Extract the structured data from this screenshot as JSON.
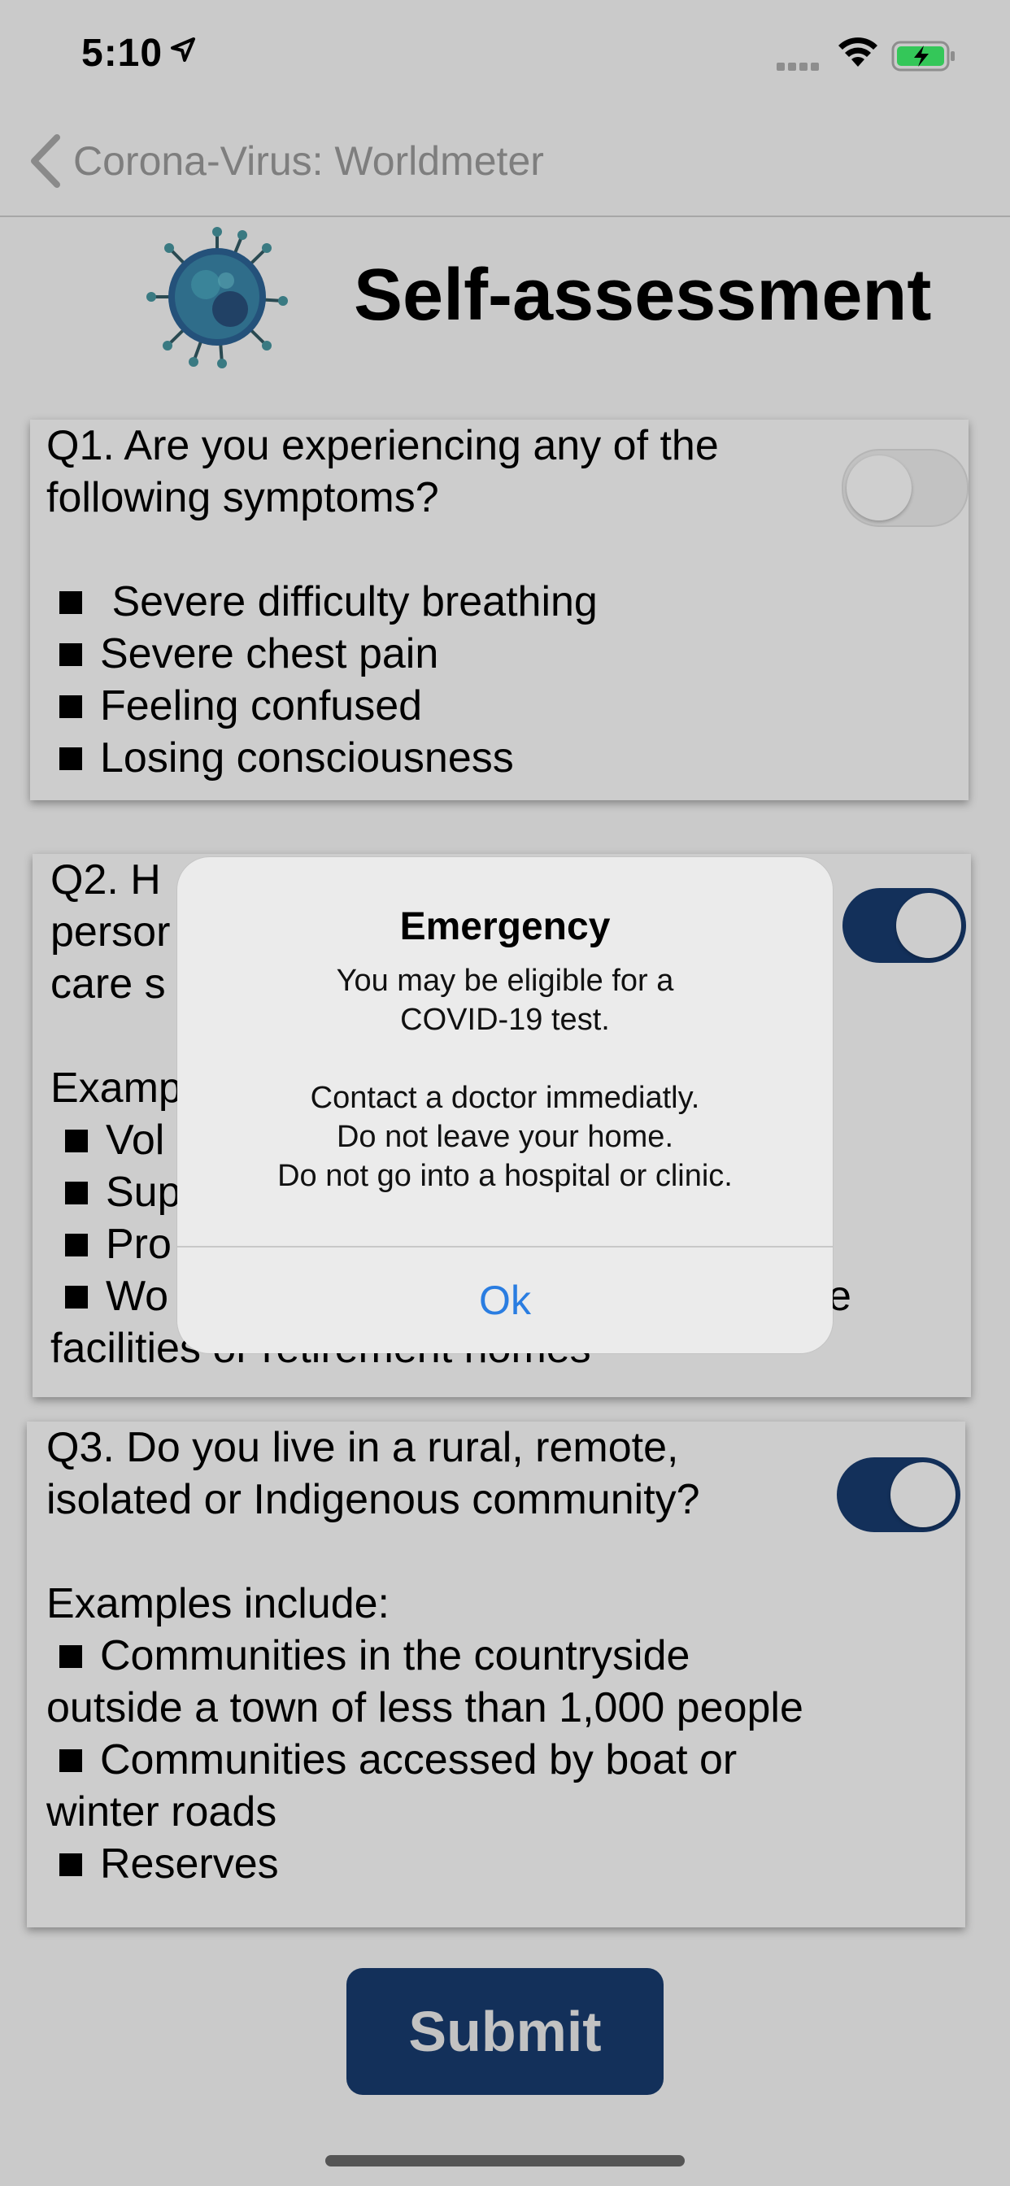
{
  "status_bar": {
    "time": "5:10",
    "icons": [
      "location-arrow-icon",
      "cellular-signal-icon",
      "wifi-icon",
      "battery-charging-icon"
    ]
  },
  "nav": {
    "back_label": "Corona-Virus: Worldmeter",
    "back_icon": "chevron-left-icon"
  },
  "header": {
    "title": "Self-assessment",
    "logo": "virus-icon"
  },
  "q1": {
    "lines": [
      "Q1.  Are you experiencing any of the",
      "following symptoms?"
    ],
    "bullets": [
      " Severe difficulty breathing",
      "Severe chest pain",
      "Feeling confused",
      "Losing consciousness"
    ],
    "toggle_on": false
  },
  "q2": {
    "visible_lines": [
      "Q2.  H",
      "persor",
      "care s",
      "Examp"
    ],
    "visible_bullets": [
      "Vol",
      "Sup",
      "Pro",
      "Wo"
    ],
    "bullet_tail": "e",
    "last_line": "facilities or retirement homes",
    "toggle_on": true
  },
  "q3": {
    "lines": [
      "Q3.  Do you live in a rural, remote,",
      "isolated or Indigenous community?",
      "Examples include:"
    ],
    "items": [
      {
        "first": "Communities in the countryside",
        "second": "outside a town of less than 1,000 people"
      },
      {
        "first": "Communities accessed by boat or",
        "second": "winter roads"
      },
      {
        "first": "Reserves",
        "second": ""
      }
    ],
    "toggle_on": true
  },
  "submit": {
    "label": "Submit"
  },
  "alert": {
    "title": "Emergency",
    "message_lines": [
      "You may be eligible for a",
      "COVID-19 test.",
      "",
      "Contact a doctor immediatly.",
      "Do not leave your home.",
      "Do not go into a hospital or clinic."
    ],
    "ok_label": "Ok"
  },
  "colors": {
    "accent": "#13305a",
    "alert_button": "#2a7de1",
    "background": "#cacaca",
    "battery": "#34c759"
  }
}
